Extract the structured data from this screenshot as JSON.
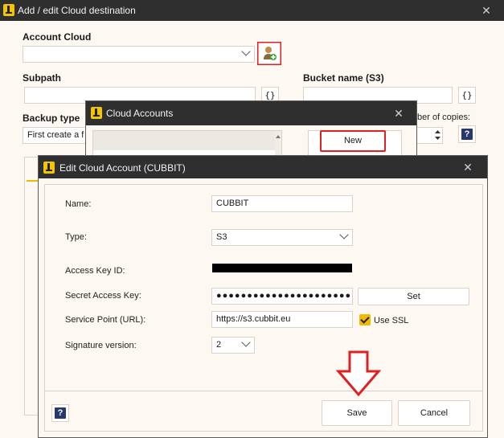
{
  "main_window": {
    "title": "Add / edit Cloud destination",
    "account_cloud_label": "Account Cloud",
    "account_cloud_value": "",
    "subpath_label": "Subpath",
    "subpath_value": "",
    "bucket_label": "Bucket name (S3)",
    "bucket_value": "",
    "brace_label": "{}",
    "backup_type_label": "Backup type",
    "backup_type_value": "First create a f",
    "copies_label": "ber of copies:",
    "copies_value": "",
    "help_label": "?"
  },
  "cloud_accounts_dialog": {
    "title": "Cloud Accounts",
    "new_button": "New"
  },
  "edit_account_dialog": {
    "title": "Edit Cloud Account (CUBBIT)",
    "name_label": "Name:",
    "name_value": "CUBBIT",
    "type_label": "Type:",
    "type_value": "S3",
    "access_key_label": "Access Key ID:",
    "secret_key_label": "Secret Access Key:",
    "secret_key_value": "●●●●●●●●●●●●●●●●●●●●●●●●●●●",
    "set_button": "Set",
    "service_point_label": "Service Point (URL):",
    "service_point_value": "https://s3.cubbit.eu",
    "use_ssl_label": "Use SSL",
    "use_ssl_checked": true,
    "signature_label": "Signature version:",
    "signature_value": "2",
    "save_button": "Save",
    "cancel_button": "Cancel",
    "help_label": "?"
  },
  "colors": {
    "titlebar": "#2f2f2f",
    "background": "#fdf8f2",
    "highlight_red": "#e02020",
    "accent_yellow": "#f2b900"
  },
  "icons": [
    "app-logo-icon",
    "close-icon",
    "chevron-down-icon",
    "add-user-icon",
    "help-icon",
    "checkbox-checked-icon",
    "down-arrow-annotation"
  ]
}
